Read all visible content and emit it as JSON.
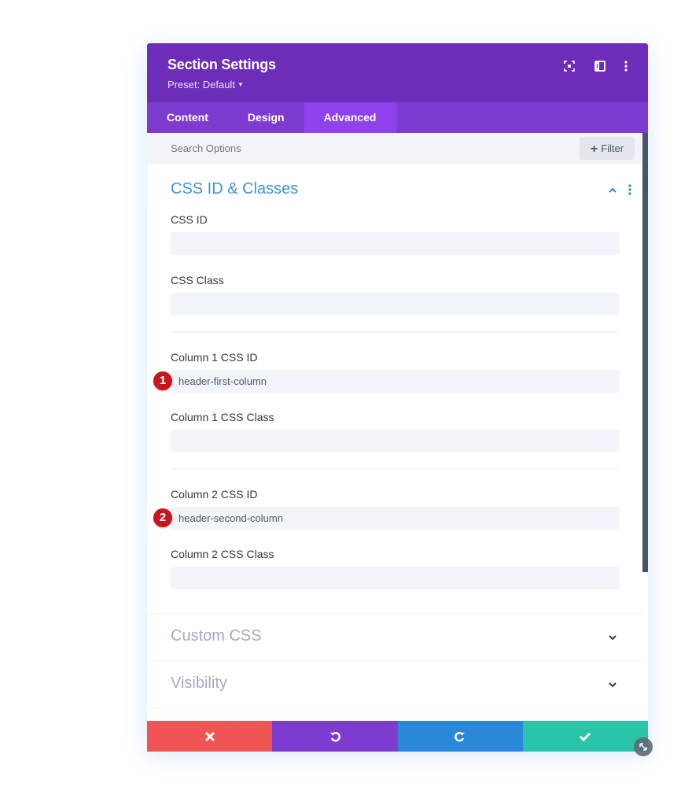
{
  "header": {
    "title": "Section Settings",
    "preset_label": "Preset: Default",
    "icons": [
      "fullscreen-icon",
      "split-view-icon",
      "more-options-icon"
    ]
  },
  "tabs": [
    {
      "label": "Content",
      "active": false
    },
    {
      "label": "Design",
      "active": false
    },
    {
      "label": "Advanced",
      "active": true
    }
  ],
  "search": {
    "placeholder": "Search Options",
    "filter_label": "Filter"
  },
  "sections": {
    "css_id_classes": {
      "title": "CSS ID & Classes",
      "expanded": true,
      "fields": [
        {
          "label": "CSS ID",
          "value": ""
        },
        {
          "label": "CSS Class",
          "value": ""
        },
        {
          "label": "Column 1 CSS ID",
          "value": "header-first-column",
          "badge": "1"
        },
        {
          "label": "Column 1 CSS Class",
          "value": ""
        },
        {
          "label": "Column 2 CSS ID",
          "value": "header-second-column",
          "badge": "2"
        },
        {
          "label": "Column 2 CSS Class",
          "value": ""
        }
      ]
    },
    "custom_css": {
      "title": "Custom CSS",
      "expanded": false
    },
    "visibility": {
      "title": "Visibility",
      "expanded": false
    }
  },
  "footer": {
    "buttons": [
      {
        "name": "discard",
        "icon": "close-icon",
        "color": "#ef5555"
      },
      {
        "name": "undo",
        "icon": "undo-icon",
        "color": "#7e3bd0"
      },
      {
        "name": "redo",
        "icon": "redo-icon",
        "color": "#2b87da"
      },
      {
        "name": "save",
        "icon": "check-icon",
        "color": "#29c4a9"
      }
    ]
  },
  "colors": {
    "header_bg": "#6c2eb9",
    "tabs_bg": "#7e3bd0",
    "active_tab_bg": "#8f42ec",
    "section_title": "#2b87da",
    "badge": "#c8161d"
  }
}
